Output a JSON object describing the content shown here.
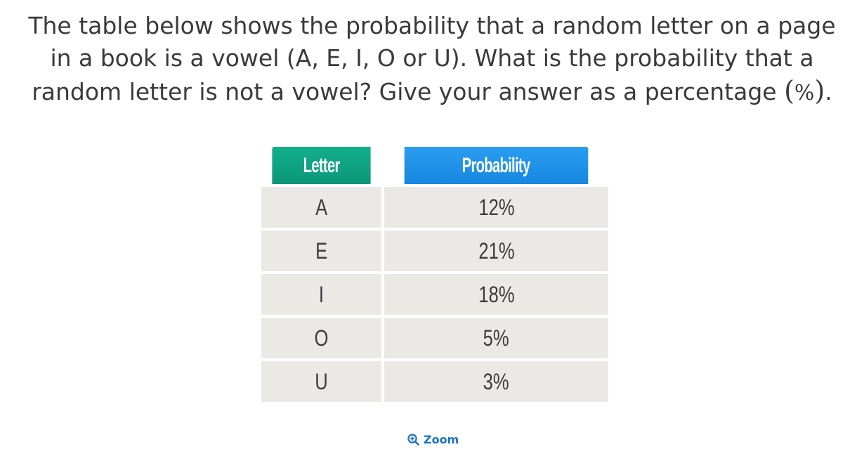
{
  "question": {
    "line1": "The table below shows the probability that a random letter on a page",
    "line2": "in a book is a vowel (A, E, I, O or U). What is the probability that a",
    "line3_text": "random letter is not a vowel? Give your answer as a percentage ",
    "line3_open_paren": "(",
    "line3_percent": "%",
    "line3_close_paren": ")",
    "line3_period": "."
  },
  "table": {
    "headers": [
      "Letter",
      "Probability"
    ],
    "rows": [
      [
        "A",
        "12%"
      ],
      [
        "E",
        "21%"
      ],
      [
        "I",
        "18%"
      ],
      [
        "O",
        "5%"
      ],
      [
        "U",
        "3%"
      ]
    ]
  },
  "zoom": {
    "label": "Zoom",
    "icon": "zoom-in-icon"
  },
  "colors": {
    "letter_header": "#0ea182",
    "probability_header": "#1f92e8",
    "cell_background": "#ebe9e6",
    "zoom_link": "#1a73c8"
  }
}
